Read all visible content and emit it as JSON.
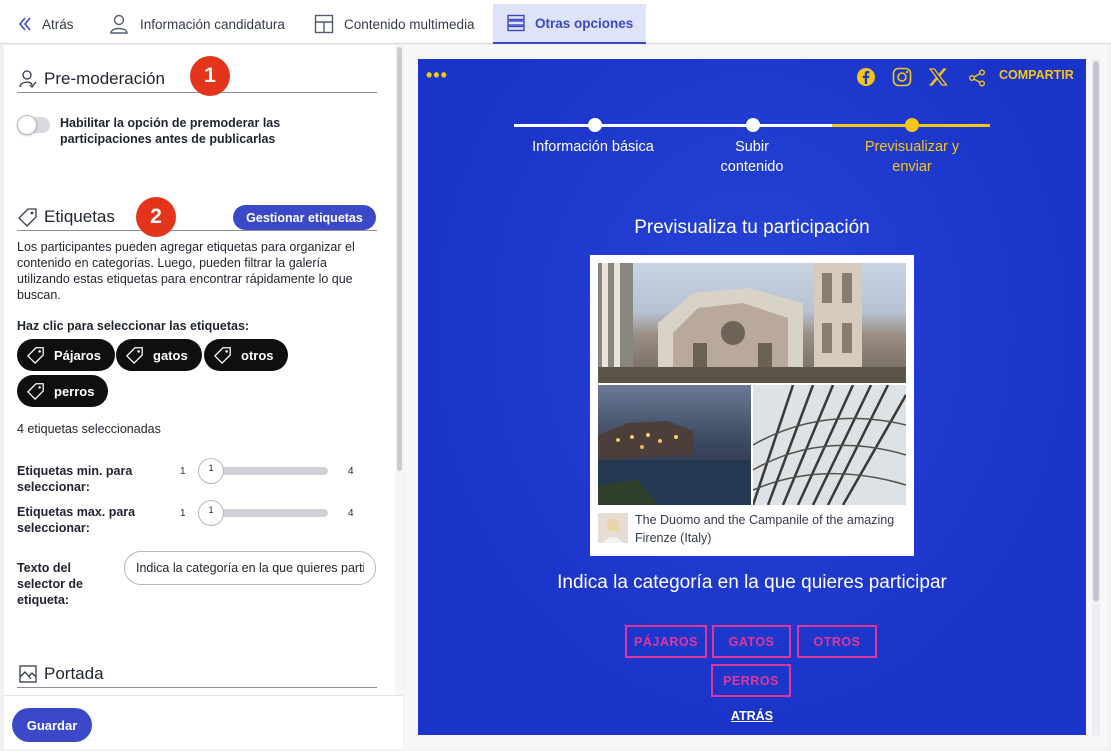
{
  "topbar": {
    "back": "Atrás",
    "candidacy_info": "Información candidatura",
    "multimedia": "Contenido multimedia",
    "other_options": "Otras opciones"
  },
  "premoderation": {
    "title": "Pre-moderación",
    "badge": "1",
    "toggle_label": "Habilitar la opción de premoderar las participaciones antes de publicarlas",
    "toggle_on": false
  },
  "tags": {
    "title": "Etiquetas",
    "badge": "2",
    "manage_button": "Gestionar etiquetas",
    "description": "Los participantes pueden agregar etiquetas para organizar el contenido en categorías. Luego, pueden filtrar la galería utilizando estas etiquetas para encontrar rápidamente lo que buscan.",
    "select_title": "Haz clic para seleccionar las etiquetas:",
    "chips": [
      "Pájaros",
      "gatos",
      "otros",
      "perros"
    ],
    "selected_count": "4 etiquetas seleccionadas",
    "min_label": "Etiquetas min. para seleccionar:",
    "max_label": "Etiquetas max. para seleccionar:",
    "slider_min": "1",
    "slider_max": "4",
    "min_value": "1",
    "max_value": "1",
    "selector_text_label": "Texto del selector de etiqueta:",
    "selector_text_value": "Indica la categoría en la que quieres participar"
  },
  "cover": {
    "title": "Portada"
  },
  "footer": {
    "save": "Guardar"
  },
  "preview": {
    "menu_dots": "•••",
    "share": "COMPARTIR",
    "steps": [
      {
        "label": "Información básica",
        "state": "done"
      },
      {
        "label": "Subir contenido",
        "state": "done"
      },
      {
        "label": "Previsualizar y enviar",
        "state": "current"
      }
    ],
    "title": "Previsualiza tu participación",
    "caption": "The Duomo and the Campanile of the amazing Firenze (Italy)",
    "question": "Indica la categoría en la que quieres participar",
    "categories": [
      "PÁJAROS",
      "GATOS",
      "OTROS",
      "PERROS"
    ],
    "back": "ATRÁS"
  },
  "colors": {
    "accent": "#3b49c9",
    "preview_bg": "#1a34c9",
    "preview_highlight": "#f5c518",
    "category_border": "#e0369b",
    "badge": "#e5341c"
  }
}
